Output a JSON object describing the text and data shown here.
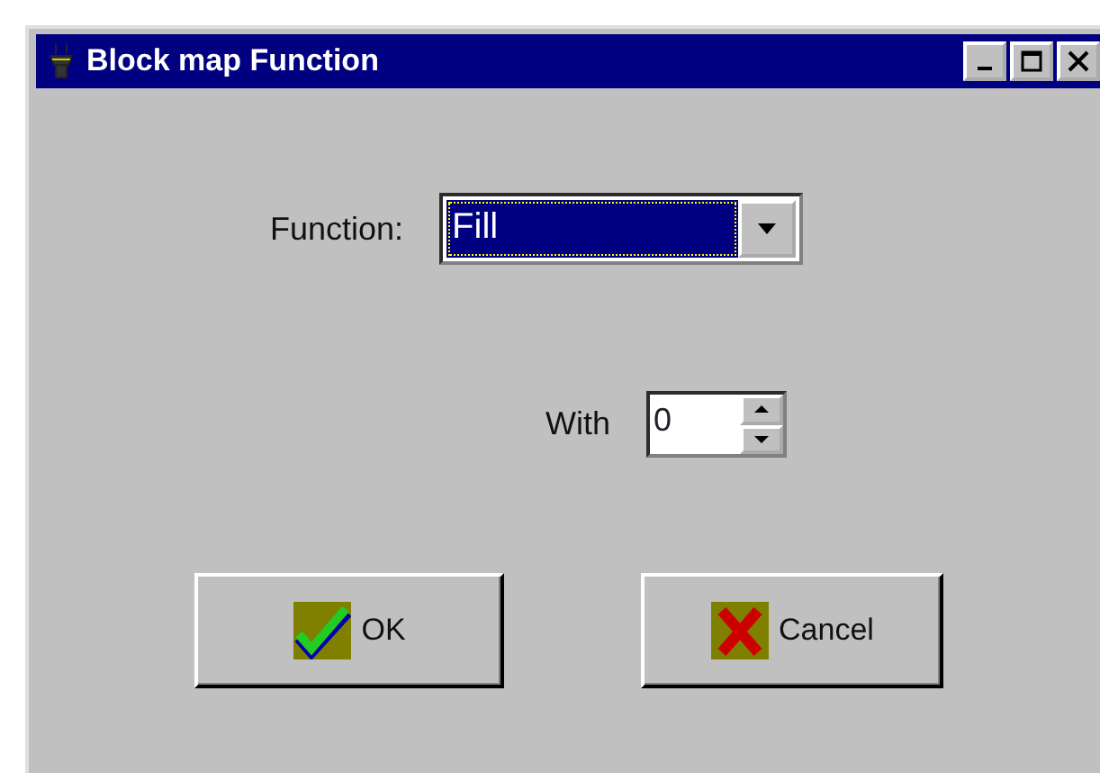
{
  "window": {
    "title": "Block map Function"
  },
  "function_field": {
    "label": "Function:",
    "value": "Fill",
    "focused": true
  },
  "with_field": {
    "label": "With",
    "value": "0"
  },
  "buttons": [
    {
      "label": "OK",
      "kind": "ok"
    },
    {
      "label": "Cancel",
      "kind": "cancel"
    }
  ]
}
